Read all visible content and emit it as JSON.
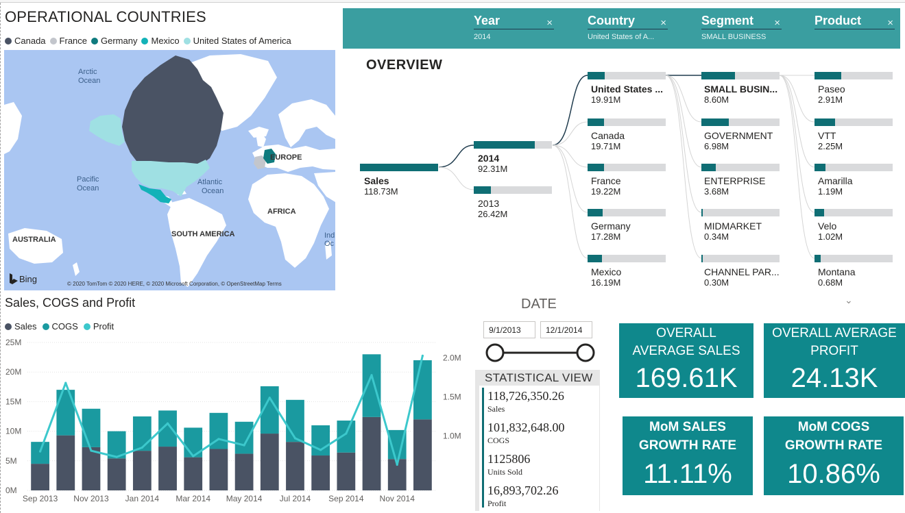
{
  "map": {
    "title": "OPERATIONAL COUNTRIES",
    "legend": [
      {
        "label": "Canada",
        "color": "#4a5364"
      },
      {
        "label": "France",
        "color": "#c3c6cc"
      },
      {
        "label": "Germany",
        "color": "#0f7b7e"
      },
      {
        "label": "Mexico",
        "color": "#13b2b8"
      },
      {
        "label": "United States of America",
        "color": "#9fe0e3"
      }
    ],
    "labels": {
      "arctic": "Arctic",
      "arctic2": "Ocean",
      "pacific": "Pacific",
      "pacific2": "Ocean",
      "atlantic": "Atlantic",
      "atlantic2": "Ocean",
      "europe": "EUROPE",
      "africa": "AFRICA",
      "south_america": "SOUTH AMERICA",
      "australia": "AUSTRALIA",
      "indian": "Ind",
      "indian2": "Oc",
      "bing": "Bing",
      "copyright": "© 2020 TomTom © 2020 HERE, © 2020 Microsoft Corporation, © OpenStreetMap  Terms"
    }
  },
  "slicers": [
    {
      "title": "Year",
      "value": "2014"
    },
    {
      "title": "Country",
      "value": "United States of A..."
    },
    {
      "title": "Segment",
      "value": "SMALL BUSINESS"
    },
    {
      "title": "Product",
      "value": ""
    }
  ],
  "slicer_clear_glyph": "×",
  "overview": {
    "title": "OVERVIEW",
    "root": {
      "label": "Sales",
      "value": "118.73M",
      "fill": 1.0
    },
    "years": [
      {
        "label": "2014",
        "value": "92.31M",
        "fill": 0.78,
        "bold": true
      },
      {
        "label": "2013",
        "value": "26.42M",
        "fill": 0.22,
        "bold": false
      }
    ],
    "countries": [
      {
        "label": "United States ...",
        "value": "19.91M",
        "fill": 0.22,
        "bold": true
      },
      {
        "label": "Canada",
        "value": "19.71M",
        "fill": 0.21,
        "bold": false
      },
      {
        "label": "France",
        "value": "19.22M",
        "fill": 0.21,
        "bold": false
      },
      {
        "label": "Germany",
        "value": "17.28M",
        "fill": 0.19,
        "bold": false
      },
      {
        "label": "Mexico",
        "value": "16.19M",
        "fill": 0.18,
        "bold": false
      }
    ],
    "segments": [
      {
        "label": "SMALL BUSIN...",
        "value": "8.60M",
        "fill": 0.43,
        "bold": true
      },
      {
        "label": "GOVERNMENT",
        "value": "6.98M",
        "fill": 0.35,
        "bold": false
      },
      {
        "label": "ENTERPRISE",
        "value": "3.68M",
        "fill": 0.18,
        "bold": false
      },
      {
        "label": "MIDMARKET",
        "value": "0.34M",
        "fill": 0.02,
        "bold": false
      },
      {
        "label": "CHANNEL PAR...",
        "value": "0.30M",
        "fill": 0.02,
        "bold": false
      }
    ],
    "products": [
      {
        "label": "Paseo",
        "value": "2.91M",
        "fill": 0.34,
        "bold": false
      },
      {
        "label": "VTT",
        "value": "2.25M",
        "fill": 0.26,
        "bold": false
      },
      {
        "label": "Amarilla",
        "value": "1.19M",
        "fill": 0.14,
        "bold": false
      },
      {
        "label": "Velo",
        "value": "1.02M",
        "fill": 0.12,
        "bold": false
      },
      {
        "label": "Montana",
        "value": "0.68M",
        "fill": 0.08,
        "bold": false
      }
    ],
    "expand_glyph": "⌄"
  },
  "chart_data": {
    "type": "bar",
    "title": "Sales, COGS and Profit",
    "legend": [
      {
        "label": "Sales",
        "color": "#4a5364"
      },
      {
        "label": "COGS",
        "color": "#1a9aa0"
      },
      {
        "label": "Profit",
        "color": "#3cc8cc"
      }
    ],
    "categories": [
      "Sep 2013",
      "Oct 2013",
      "Nov 2013",
      "Dec 2013",
      "Jan 2014",
      "Feb 2014",
      "Mar 2014",
      "Apr 2014",
      "May 2014",
      "Jun 2014",
      "Jul 2014",
      "Aug 2014",
      "Sep 2014",
      "Oct 2014",
      "Nov 2014",
      "Dec 2014"
    ],
    "xtick_labels": [
      "Sep 2013",
      "Nov 2013",
      "Jan 2014",
      "Mar 2014",
      "May 2014",
      "Jul 2014",
      "Sep 2014",
      "Nov 2014"
    ],
    "series": [
      {
        "name": "Sales",
        "values": [
          4.5,
          9.3,
          7.3,
          5.4,
          6.7,
          7.4,
          5.6,
          7.0,
          6.2,
          9.6,
          8.2,
          5.9,
          6.4,
          12.4,
          5.3,
          12.0
        ]
      },
      {
        "name": "COGS",
        "values": [
          3.7,
          7.7,
          6.5,
          4.6,
          5.8,
          6.1,
          5.0,
          6.1,
          5.4,
          8.0,
          7.1,
          5.1,
          5.4,
          10.6,
          4.9,
          10.0
        ]
      },
      {
        "name": "Profit",
        "values": [
          0.8,
          1.68,
          0.81,
          0.73,
          0.85,
          1.16,
          0.74,
          0.96,
          0.88,
          1.49,
          0.97,
          0.82,
          1.03,
          1.78,
          0.63,
          2.03
        ]
      }
    ],
    "y_left": {
      "min": 0,
      "max": 25,
      "ticks": [
        "0M",
        "5M",
        "10M",
        "15M",
        "20M",
        "25M"
      ]
    },
    "y_right": {
      "min": 0.3,
      "max": 2.2,
      "ticks": [
        {
          "v": 1.0,
          "label": "1.0M"
        },
        {
          "v": 1.5,
          "label": "1.5M"
        },
        {
          "v": 2.0,
          "label": "2.0M"
        }
      ]
    },
    "colors": {
      "sales": "#4a5364",
      "cogs": "#1a9aa0",
      "profit": "#3cc8cc"
    }
  },
  "date": {
    "title": "DATE",
    "start": "9/1/2013",
    "end": "12/1/2014"
  },
  "stats": {
    "title": "STATISTICAL VIEW",
    "items": [
      {
        "value": "118,726,350.26",
        "label": "Sales"
      },
      {
        "value": "101,832,648.00",
        "label": "COGS"
      },
      {
        "value": "1125806",
        "label": "Units Sold"
      },
      {
        "value": "16,893,702.26",
        "label": "Profit"
      }
    ]
  },
  "kpis": [
    {
      "title": "OVERALL AVERAGE SALES",
      "value": "169.61K"
    },
    {
      "title": "OVERALL AVERAGE PROFIT",
      "value": "24.13K"
    },
    {
      "title": "MoM SALES GROWTH RATE",
      "value": "11.11%"
    },
    {
      "title": "MoM COGS GROWTH RATE",
      "value": "10.86%"
    }
  ],
  "colors": {
    "teal_header": "#3a9ea0",
    "kpi_bg": "#0f888c",
    "tree_bar": "#0f6e74",
    "tree_track": "#d9dadc",
    "map_ocean": "#aac6f2",
    "map_land": "#ffffff"
  }
}
